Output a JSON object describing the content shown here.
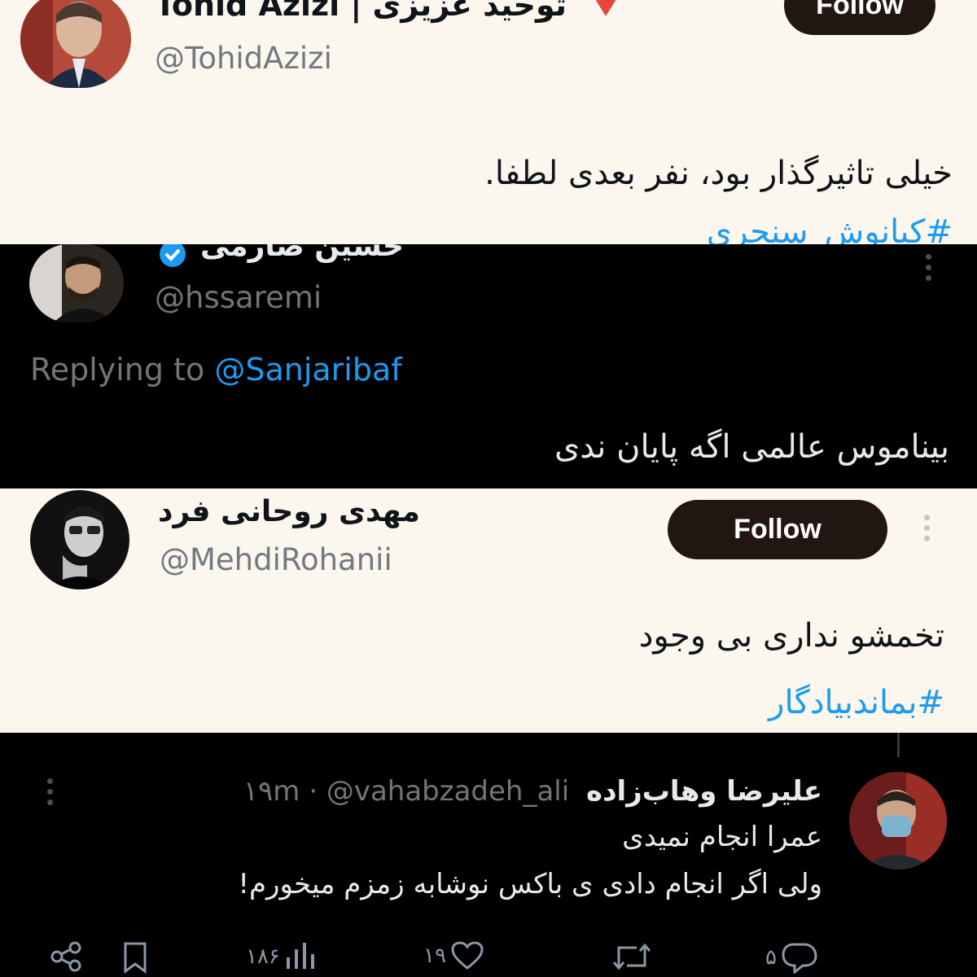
{
  "tweet1": {
    "display_name": "Tohid Azizi | توحید عزیزی",
    "handle": "@TohidAzizi",
    "follow_label": "Follow",
    "text": "خیلی تاثیرگذار بود، نفر بعدی لطفا.",
    "hashtag": "#کیانوش_سنجری"
  },
  "tweet2": {
    "display_name": "حسین صارمی",
    "handle": "@hssaremi",
    "replying_prefix": "Replying to",
    "replying_handle": "@Sanjaribaf",
    "text": "بیناموس عالمی اگه پایان ندی"
  },
  "tweet3": {
    "display_name": "مهدی روحانی فرد",
    "handle": "@MehdiRohanii",
    "follow_label": "Follow",
    "text": "تخمشو نداری بی وجود",
    "hashtag": "#بماندبیادگار"
  },
  "tweet4": {
    "display_name": "علیرضا وهاب‌زاده",
    "handle_time": "۱۹m · @vahabzadeh_ali",
    "line1": "عمرا انجام نمیدی",
    "line2": "ولی اگر انجام دادی ی باکس نوشابه زمزم میخورم!",
    "views": "۱۸۶",
    "likes": "۱۹",
    "replies": "۵"
  },
  "colors": {
    "light_bg": "#fbf6ee",
    "dark_bg": "#000000",
    "link": "#1d9bf0",
    "follow_bg": "#221613"
  }
}
